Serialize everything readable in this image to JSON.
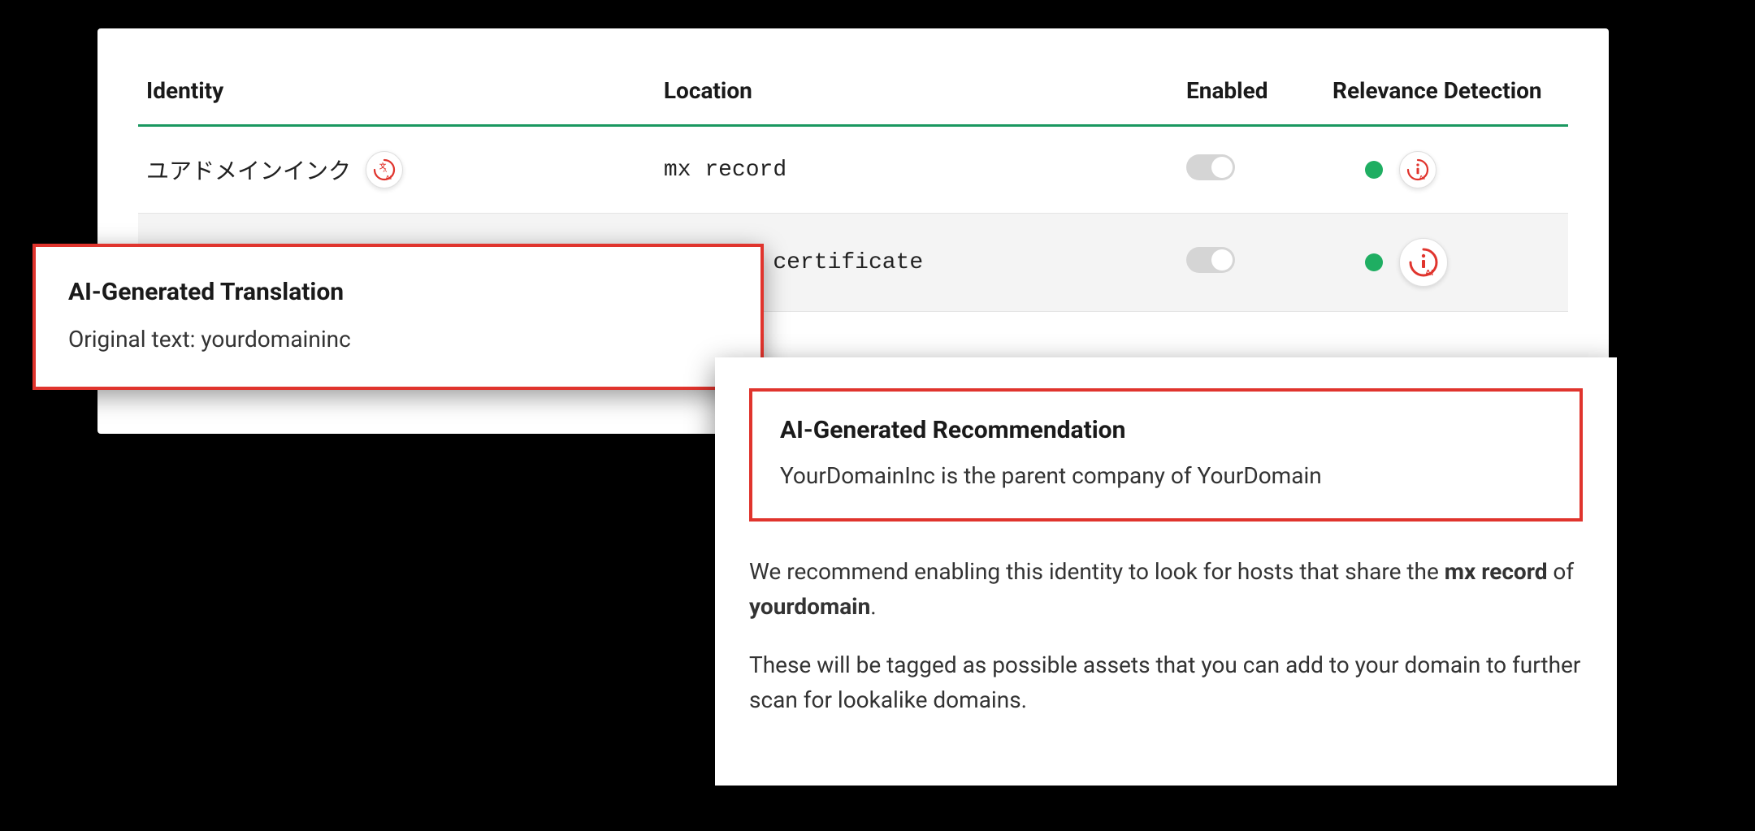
{
  "table": {
    "headers": {
      "identity": "Identity",
      "location": "Location",
      "enabled": "Enabled",
      "relevance": "Relevance Detection"
    },
    "rows": [
      {
        "identity": "ユアドメインインク",
        "location": "mx record",
        "enabled": false,
        "relevance_status": "green"
      },
      {
        "identity": "",
        "location": "me from certificate",
        "enabled": false,
        "relevance_status": "green"
      }
    ]
  },
  "translation_popup": {
    "title": "AI-Generated Translation",
    "original_label": "Original text: ",
    "original_text": "yourdomaininc"
  },
  "recommendation_popup": {
    "title": "AI-Generated Recommendation",
    "summary": "YourDomainInc is the parent company of YourDomain",
    "para1_prefix": "We recommend enabling this identity to look for hosts that share the ",
    "para1_bold1": "mx record",
    "para1_mid": " of ",
    "para1_bold2": "yourdomain",
    "para1_suffix": ".",
    "para2": "These will be tagged as possible assets that you can add to your domain to further scan for lookalike domains."
  },
  "colors": {
    "accent_green": "#1a9860",
    "status_green": "#1fae62",
    "ai_red": "#e0342d"
  }
}
